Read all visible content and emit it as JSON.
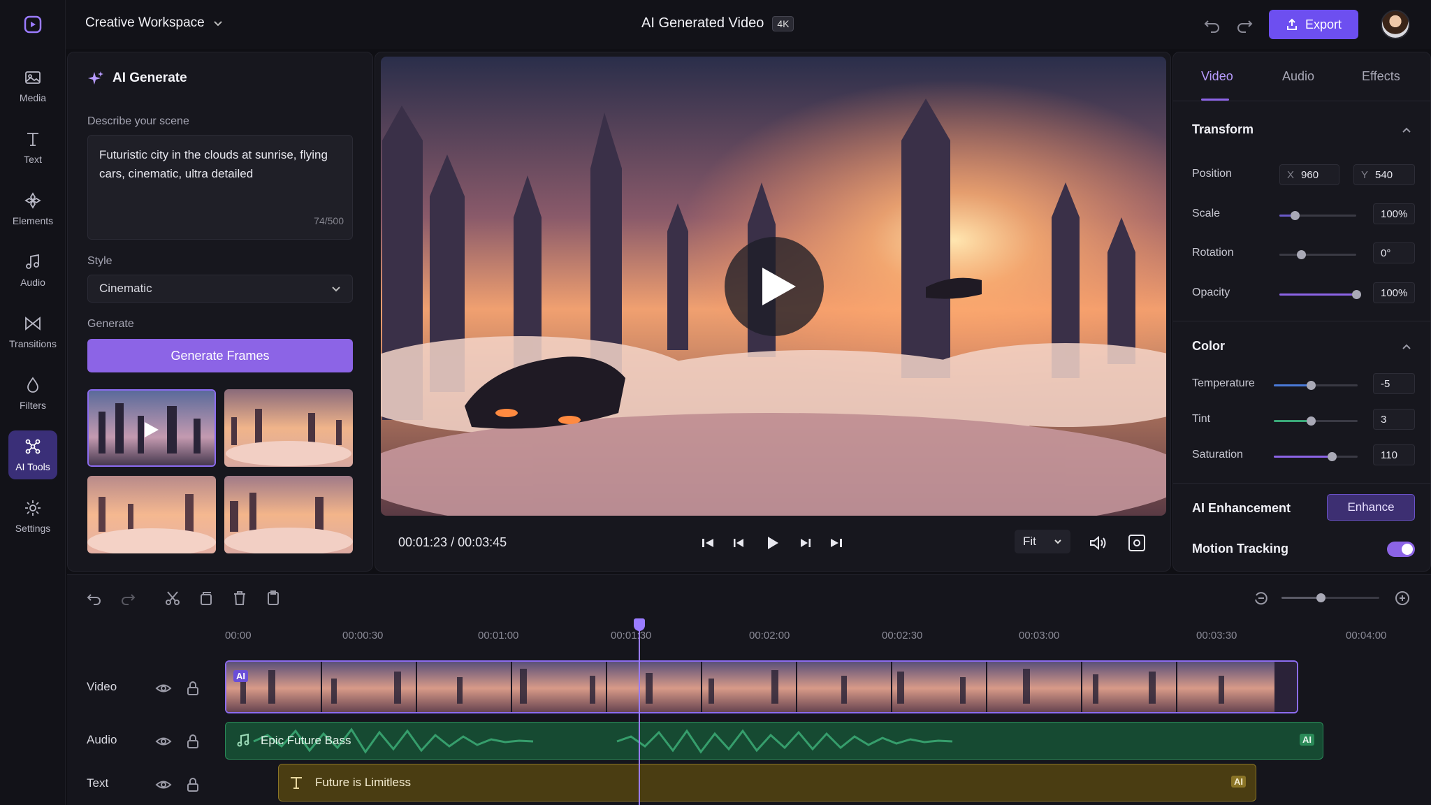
{
  "app": {
    "workspace": "Creative Workspace",
    "title": "AI Generated Video",
    "resolution_badge": "4K",
    "export_label": "Export",
    "accent": "#6d4ff0"
  },
  "rail": [
    {
      "label": "Media",
      "icon": "media-icon"
    },
    {
      "label": "Text",
      "icon": "text-icon"
    },
    {
      "label": "Elements",
      "icon": "elements-icon"
    },
    {
      "label": "Audio",
      "icon": "music-note-icon"
    },
    {
      "label": "Transitions",
      "icon": "transition-icon"
    },
    {
      "label": "Filters",
      "icon": "filter-icon"
    },
    {
      "label": "AI Tools",
      "icon": "ai-tools-icon",
      "active": true
    },
    {
      "label": "Settings",
      "icon": "gear-icon"
    }
  ],
  "ai_panel": {
    "title": "AI Generate",
    "scene_label": "Describe your scene",
    "scene_text": "Futuristic city in the clouds at sunrise, flying cars, cinematic, ultra detailed",
    "char_count": "74/500",
    "style_label": "Style",
    "style_value": "Cinematic",
    "generate_label": "Generate",
    "generate_button": "Generate Frames"
  },
  "preview": {
    "current_time": "00:01:23",
    "separator": "/",
    "total_time": "00:03:45",
    "fit_label": "Fit"
  },
  "inspector": {
    "tabs": [
      "Video",
      "Audio",
      "Effects"
    ],
    "active_tab": "Video",
    "transform": {
      "title": "Transform",
      "position_label": "Position",
      "pos_x_axis": "X",
      "pos_x": "960",
      "pos_y_axis": "Y",
      "pos_y": "540",
      "scale_label": "Scale",
      "scale_value": "100%",
      "scale_level": 0.2,
      "rotation_label": "Rotation",
      "rotation_value": "0°",
      "rotation_level": 0.28,
      "opacity_label": "Opacity",
      "opacity_value": "100%",
      "opacity_level": 1.0
    },
    "color": {
      "title": "Color",
      "temperature_label": "Temperature",
      "temperature_value": "-5",
      "temperature_level": 0.44,
      "tint_label": "Tint",
      "tint_value": "3",
      "tint_level": 0.44,
      "saturation_label": "Saturation",
      "saturation_value": "110",
      "saturation_level": 0.69
    },
    "ai_enhancement_label": "AI Enhancement",
    "enhance_button": "Enhance",
    "motion_tracking_label": "Motion Tracking",
    "motion_tracking_on": true
  },
  "timeline": {
    "ticks": [
      "00:00",
      "00:00:30",
      "00:01:00",
      "00:01:30",
      "00:02:00",
      "00:02:30",
      "00:03:00",
      "00:03:30",
      "00:04:00"
    ],
    "tracks": {
      "video": "Video",
      "audio": "Audio",
      "text": "Text"
    },
    "audio_clip": "Epic Future Bass",
    "text_clip": "Future is Limitless",
    "ai_badge": "AI",
    "zoom_level": 0.4
  }
}
